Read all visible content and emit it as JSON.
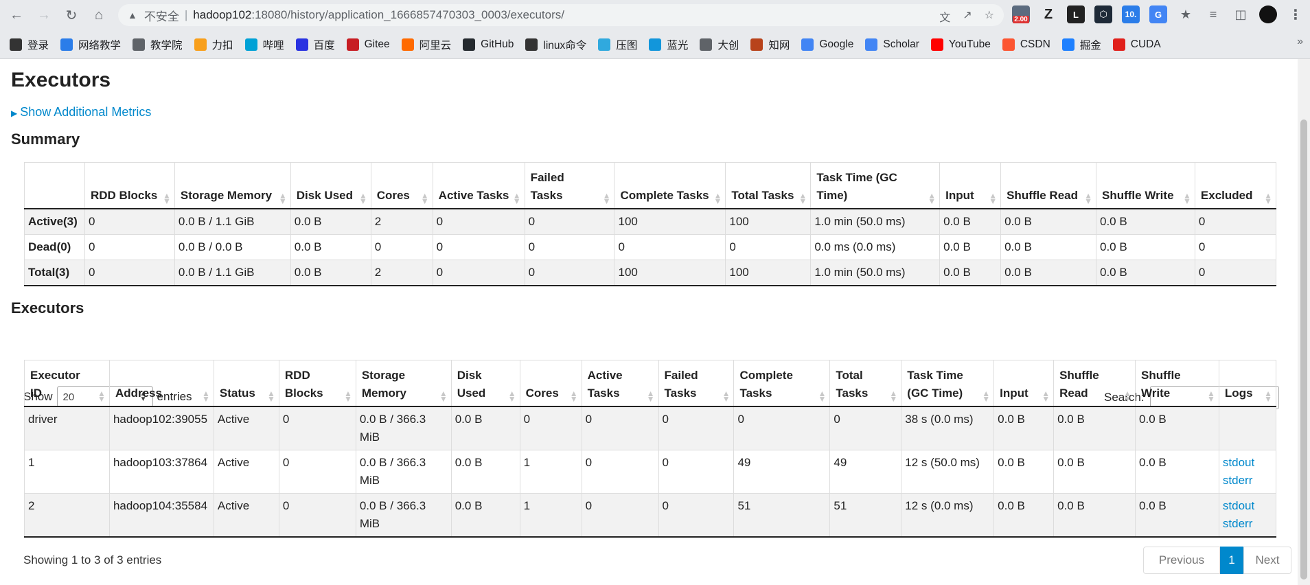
{
  "browser": {
    "insecure_label": "不安全",
    "url_host": "hadoop102",
    "url_path": ":18080/history/application_1666857470303_0003/executors/",
    "ext_badge": "2.00",
    "ext_ten": "10."
  },
  "bookmarks": [
    {
      "label": "登录",
      "icon": "login-icon",
      "color": "#333333"
    },
    {
      "label": "网络教学",
      "icon": "wangluo-icon",
      "color": "#2b7de9"
    },
    {
      "label": "教学院",
      "icon": "globe-icon",
      "color": "#5f6368"
    },
    {
      "label": "力扣",
      "icon": "leetcode-icon",
      "color": "#f89f1b"
    },
    {
      "label": "哔哩",
      "icon": "bilibili-icon",
      "color": "#00a1d6"
    },
    {
      "label": "百度",
      "icon": "baidu-icon",
      "color": "#2932e1"
    },
    {
      "label": "Gitee",
      "icon": "gitee-icon",
      "color": "#c71d23"
    },
    {
      "label": "阿里云",
      "icon": "aliyun-icon",
      "color": "#ff6a00"
    },
    {
      "label": "GitHub",
      "icon": "github-icon",
      "color": "#24292e"
    },
    {
      "label": "linux命令",
      "icon": "linux-icon",
      "color": "#333333"
    },
    {
      "label": "压图",
      "icon": "compress-icon",
      "color": "#30a9de"
    },
    {
      "label": "蓝光",
      "icon": "bluray-icon",
      "color": "#1296db"
    },
    {
      "label": "大创",
      "icon": "globe-icon",
      "color": "#5f6368"
    },
    {
      "label": "知网",
      "icon": "cnki-icon",
      "color": "#b8431b"
    },
    {
      "label": "Google",
      "icon": "google-icon",
      "color": "#4285f4"
    },
    {
      "label": "Scholar",
      "icon": "scholar-icon",
      "color": "#4285f4"
    },
    {
      "label": "YouTube",
      "icon": "youtube-icon",
      "color": "#ff0000"
    },
    {
      "label": "CSDN",
      "icon": "csdn-icon",
      "color": "#fc5531"
    },
    {
      "label": "掘金",
      "icon": "juejin-icon",
      "color": "#1e80ff"
    },
    {
      "label": "CUDA",
      "icon": "cuda-icon",
      "color": "#e0201b"
    }
  ],
  "page": {
    "title": "Executors",
    "metrics_link": "Show Additional Metrics",
    "summary_title": "Summary",
    "executors_title": "Executors"
  },
  "summary": {
    "headers": [
      "",
      "RDD Blocks",
      "Storage Memory",
      "Disk Used",
      "Cores",
      "Active Tasks",
      "Failed Tasks",
      "Complete Tasks",
      "Total Tasks",
      "Task Time (GC Time)",
      "Input",
      "Shuffle Read",
      "Shuffle Write",
      "Excluded"
    ],
    "rows": [
      [
        "Active(3)",
        "0",
        "0.0 B / 1.1 GiB",
        "0.0 B",
        "2",
        "0",
        "0",
        "100",
        "100",
        "1.0 min (50.0 ms)",
        "0.0 B",
        "0.0 B",
        "0.0 B",
        "0"
      ],
      [
        "Dead(0)",
        "0",
        "0.0 B / 0.0 B",
        "0.0 B",
        "0",
        "0",
        "0",
        "0",
        "0",
        "0.0 ms (0.0 ms)",
        "0.0 B",
        "0.0 B",
        "0.0 B",
        "0"
      ],
      [
        "Total(3)",
        "0",
        "0.0 B / 1.1 GiB",
        "0.0 B",
        "2",
        "0",
        "0",
        "100",
        "100",
        "1.0 min (50.0 ms)",
        "0.0 B",
        "0.0 B",
        "0.0 B",
        "0"
      ]
    ]
  },
  "controls": {
    "show_label": "Show",
    "entries_value": "20",
    "entries_label": "entries",
    "search_label": "Search:"
  },
  "executors": {
    "headers": [
      "Executor ID",
      "Address",
      "Status",
      "RDD Blocks",
      "Storage Memory",
      "Disk Used",
      "Cores",
      "Active Tasks",
      "Failed Tasks",
      "Complete Tasks",
      "Total Tasks",
      "Task Time (GC Time)",
      "Input",
      "Shuffle Read",
      "Shuffle Write",
      "Logs"
    ],
    "rows": [
      [
        "driver",
        "hadoop102:39055",
        "Active",
        "0",
        "0.0 B / 366.3 MiB",
        "0.0 B",
        "0",
        "0",
        "0",
        "0",
        "0",
        "38 s (0.0 ms)",
        "0.0 B",
        "0.0 B",
        "0.0 B",
        ""
      ],
      [
        "1",
        "hadoop103:37864",
        "Active",
        "0",
        "0.0 B / 366.3 MiB",
        "0.0 B",
        "1",
        "0",
        "0",
        "49",
        "49",
        "12 s (50.0 ms)",
        "0.0 B",
        "0.0 B",
        "0.0 B",
        "stdout|stderr"
      ],
      [
        "2",
        "hadoop104:35584",
        "Active",
        "0",
        "0.0 B / 366.3 MiB",
        "0.0 B",
        "1",
        "0",
        "0",
        "51",
        "51",
        "12 s (0.0 ms)",
        "0.0 B",
        "0.0 B",
        "0.0 B",
        "stdout|stderr"
      ]
    ]
  },
  "footer": {
    "showing": "Showing 1 to 3 of 3 entries",
    "prev": "Previous",
    "current": "1",
    "next": "Next"
  }
}
